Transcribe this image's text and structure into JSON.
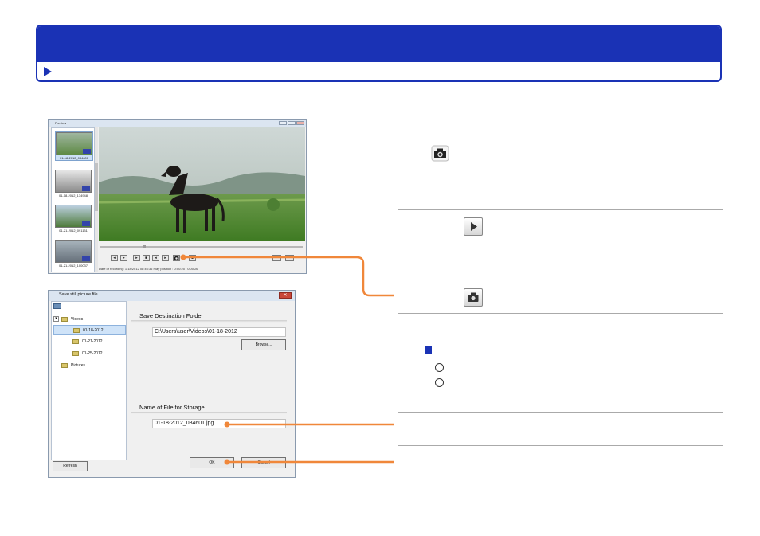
{
  "preview_window": {
    "title": "Preview",
    "thumbnails": [
      {
        "caption": "01-18-2012_084601"
      },
      {
        "caption": "01-18-2012_134948"
      },
      {
        "caption": "01-21-2012_091131"
      },
      {
        "caption": "01-21-2012_100037"
      }
    ],
    "status": "Date of recording: 1/18/2012 08:46:36    Play position : 0:00:25 / 0:00:26"
  },
  "save_dialog": {
    "title": "Save still picture file",
    "close_glyph": "✕",
    "tree": {
      "root": "Videos",
      "children": [
        "01-18-2012",
        "01-21-2012",
        "01-25-2012"
      ],
      "other": "Pictures",
      "expander": "▾"
    },
    "refresh_label": "Refresh",
    "destination_title": "Save Destination Folder",
    "destination_path": "C:\\Users\\user\\Videos\\01-18-2012",
    "browse_label": "Browse...",
    "filename_title": "Name of File for Storage",
    "filename_value": "01-18-2012_084601.jpg",
    "ok_label": "OK",
    "cancel_label": "Cancel"
  },
  "colors": {
    "brand_blue": "#1a32b5",
    "connector_orange": "#f0873a"
  },
  "icons": [
    "camera-icon",
    "play-icon",
    "camera-button-icon"
  ]
}
